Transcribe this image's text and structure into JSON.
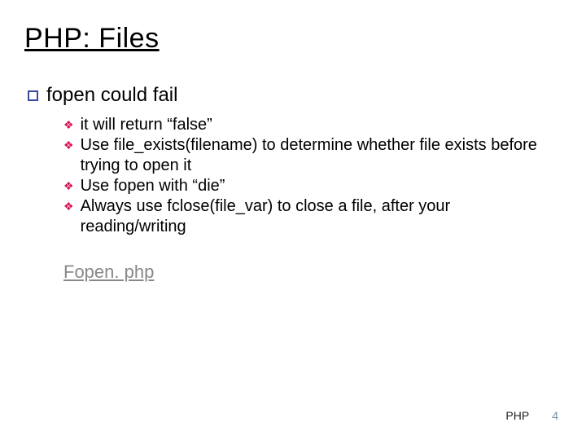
{
  "title": "PHP: Files",
  "heading": {
    "text": "fopen could fail"
  },
  "bullets": [
    {
      "text": "it will return “false”"
    },
    {
      "text": "Use file_exists(filename) to determine whether file exists before trying to open it"
    },
    {
      "text": "Use fopen with “die”"
    },
    {
      "text": "Always use fclose(file_var) to close a file, after your reading/writing"
    }
  ],
  "link": "Fopen. php",
  "footer": {
    "label": "PHP",
    "page": "4"
  }
}
